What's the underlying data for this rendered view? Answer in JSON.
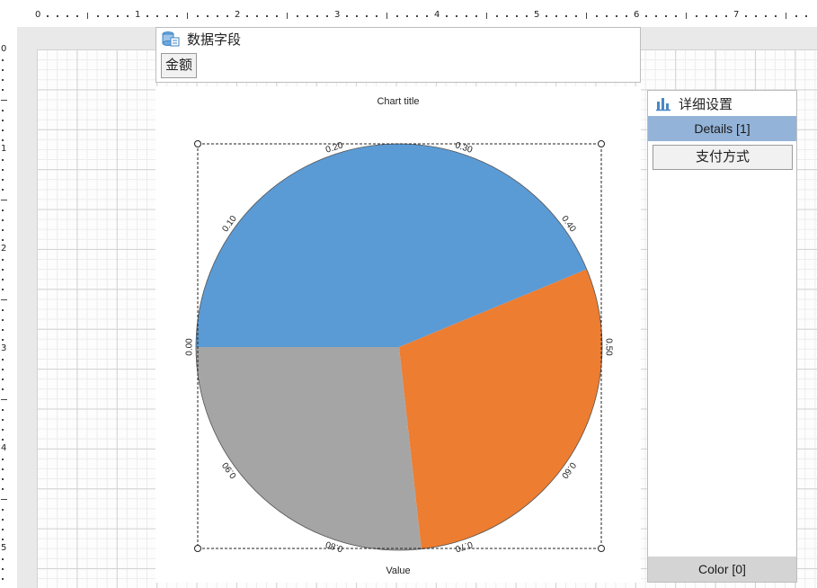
{
  "ruler": {
    "top_labels": [
      "0",
      "1",
      "2",
      "3",
      "4",
      "5",
      "6",
      "7"
    ],
    "left_labels": [
      "0",
      "1",
      "2",
      "3",
      "4",
      "5"
    ]
  },
  "fields_panel": {
    "title": "数据字段",
    "icon": "database-icon",
    "fields": [
      "金额"
    ]
  },
  "chart_data": {
    "type": "pie",
    "title": "Chart title",
    "xlabel": "Value",
    "slices": [
      {
        "start": 0.0,
        "end": 0.4375,
        "color": "#5b9bd5"
      },
      {
        "start": 0.4375,
        "end": 0.7325,
        "color": "#ed7d31"
      },
      {
        "start": 0.7325,
        "end": 1.0,
        "color": "#a5a5a5"
      }
    ],
    "axis_tick_labels": [
      "0.00",
      "0.10",
      "0.20",
      "0.30",
      "0.40",
      "0.50",
      "0.60",
      "0.70",
      "0.80",
      "0.90"
    ],
    "grid": false,
    "legend": "none"
  },
  "detail_panel": {
    "title": "详细设置",
    "icon": "bar-chart-icon",
    "details_label": "Details [1]",
    "items": [
      "支付方式"
    ],
    "color_label": "Color [0]"
  }
}
